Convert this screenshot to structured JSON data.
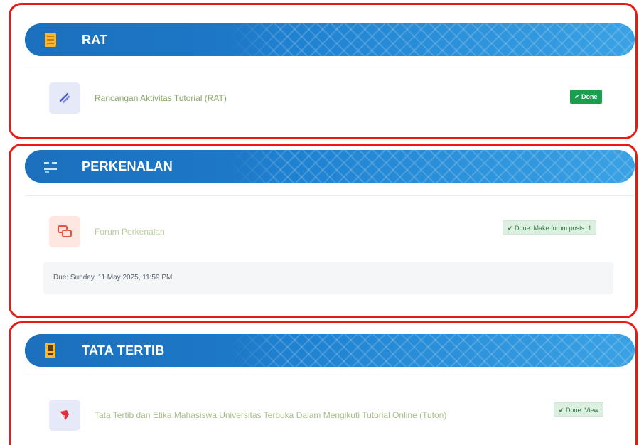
{
  "sections": [
    {
      "title": "RAT",
      "activity": {
        "name": "Rancangan Aktivitas Tutorial (RAT)",
        "status": "✔ Done"
      }
    },
    {
      "title": "PERKENALAN",
      "activity": {
        "name": "Forum Perkenalan",
        "status": "✔ Done: Make forum posts: 1"
      },
      "due": "Due: Sunday, 11 May 2025, 11:59 PM"
    },
    {
      "title": "TATA TERTIB",
      "activity": {
        "name": "Tata Tertib dan Etika Mahasiswa Universitas Terbuka Dalam Mengikuti Tutorial Online (Tuton)",
        "status": "✔ Done: View"
      }
    }
  ],
  "colors": {
    "banner": "#1d74c2",
    "highlight_border": "#e41b17",
    "done_badge": "#1a9e4f",
    "done_soft": "#dcefe0",
    "activity_link": "#8aa86a"
  },
  "icons": {
    "rat_section": "book-icon",
    "perkenalan_section": "people-icon",
    "tata_tertib_section": "rules-icon",
    "rat_activity": "file-icon",
    "forum_activity": "forum-icon",
    "tata_tertib_activity": "pdf-icon"
  }
}
